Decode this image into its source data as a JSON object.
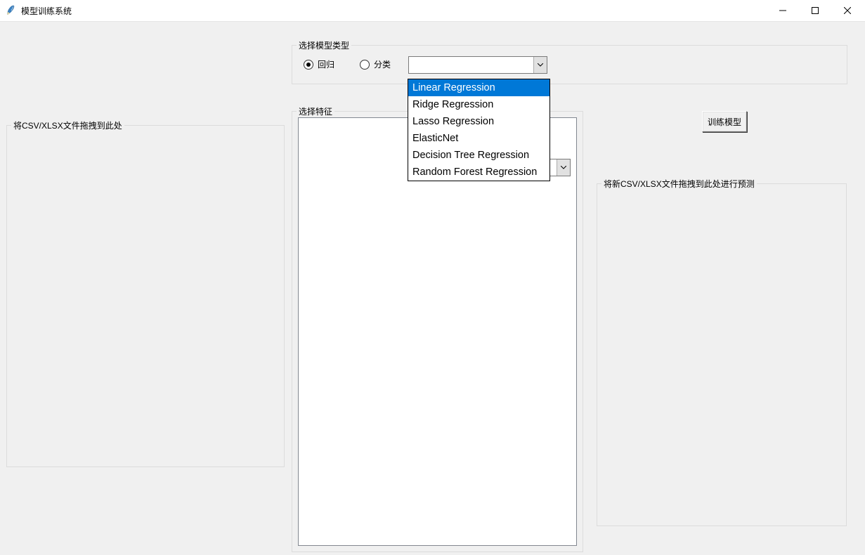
{
  "window": {
    "title": "模型训练系统"
  },
  "model_type_group": {
    "legend": "选择模型类型",
    "radio_regression": "回归",
    "radio_classification": "分类",
    "selected": "regression",
    "combo_value": "",
    "options": [
      "Linear Regression",
      "Ridge Regression",
      "Lasso Regression",
      "ElasticNet",
      "Decision Tree Regression",
      "Random Forest Regression"
    ],
    "highlighted_index": 0
  },
  "feature_group": {
    "legend": "选择特征"
  },
  "drop_zone_input": {
    "legend": "将CSV/XLSX文件拖拽到此处"
  },
  "drop_zone_predict": {
    "legend": "将新CSV/XLSX文件拖拽到此处进行预测"
  },
  "target_combo": {
    "value": ""
  },
  "train_button": {
    "label": "训练模型"
  }
}
